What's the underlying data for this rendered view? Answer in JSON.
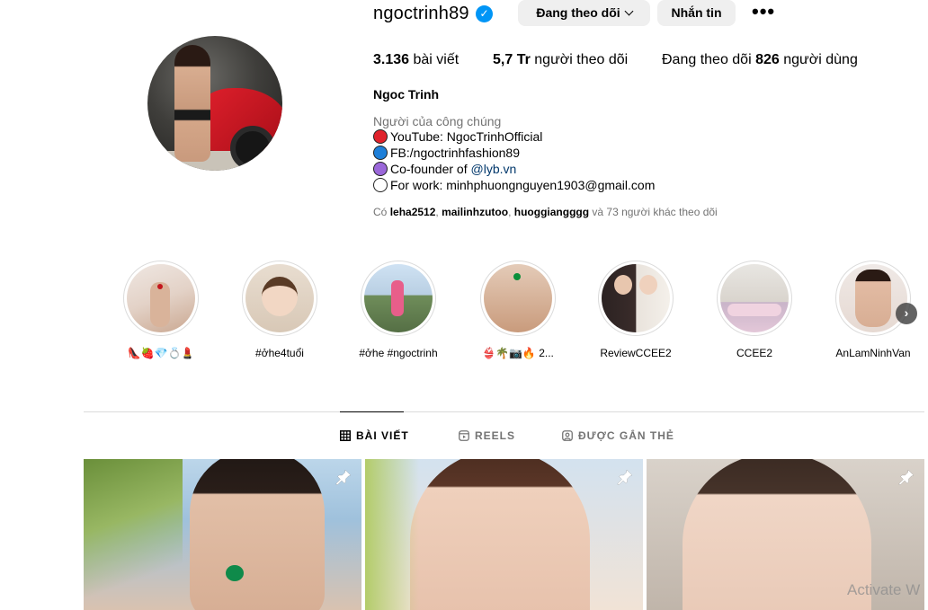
{
  "profile": {
    "username": "ngoctrinh89",
    "verified_glyph": "✓",
    "follow_button": "Đang theo dõi",
    "message_button": "Nhắn tin",
    "more_glyph": "•••",
    "posts_count": "3.136",
    "posts_label": "bài viết",
    "followers_count": "5,7 Tr",
    "followers_label": "người theo dõi",
    "following_prefix": "Đang theo dõi",
    "following_count": "826",
    "following_suffix": "người dùng",
    "full_name": "Ngoc Trinh",
    "category": "Người của công chúng",
    "bio": {
      "youtube": "YouTube: NgocTrinhOfficial",
      "facebook": "FB:/ngoctrinhfashion89",
      "cofounder_prefix": "Co-founder of ",
      "cofounder_mention": "@lyb.vn",
      "work": "For work: minhphuongnguyen1903@gmail.com"
    },
    "followed_by": {
      "prefix": "Có ",
      "user1": "leha2512",
      "sep1": ", ",
      "user2": "mailinhzutoo",
      "sep2": ", ",
      "user3": "huoggiangggg",
      "suffix": " và 73 người khác theo dõi"
    }
  },
  "highlights": [
    {
      "label": "👠🍓💎💍💄"
    },
    {
      "label": "#ởhe4tuổi"
    },
    {
      "label": "#ởhe #ngoctrinh"
    },
    {
      "label": "👙🌴📷🔥 2..."
    },
    {
      "label": "ReviewCCEE2"
    },
    {
      "label": "CCEE2"
    },
    {
      "label": "AnLamNinhVan"
    }
  ],
  "highlights_next_glyph": "›",
  "tabs": {
    "posts": "BÀI VIẾT",
    "reels": "REELS",
    "tagged": "ĐƯỢC GẮN THẺ"
  },
  "watermark": "Activate W",
  "colors": {
    "accent": "#0095f6",
    "button_bg": "#efefef",
    "muted_text": "#737373",
    "mention": "#00376b"
  }
}
